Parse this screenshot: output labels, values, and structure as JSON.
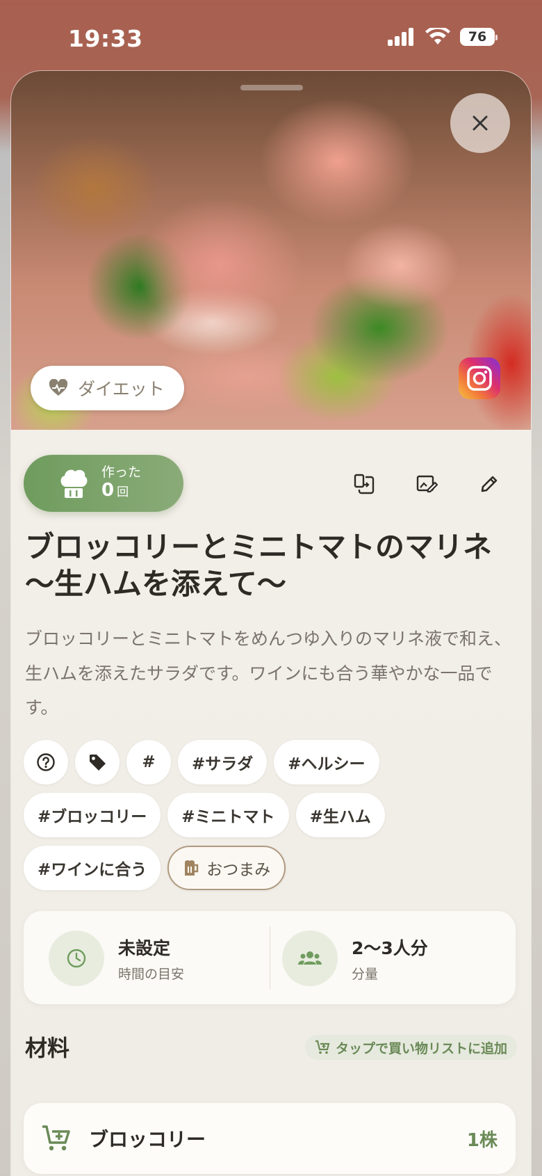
{
  "status": {
    "time": "19:33",
    "battery": "76"
  },
  "hero": {
    "category_chip": "ダイエット"
  },
  "made": {
    "label": "作った",
    "count": "0",
    "unit": "回"
  },
  "recipe": {
    "title": "ブロッコリーとミニトマトのマリネ 〜生ハムを添えて〜",
    "description": "ブロッコリーとミニトマトをめんつゆ入りのマリネ液で和え、生ハムを添えたサラダです。ワインにも合う華やかな一品です。"
  },
  "tags": {
    "hash_icon": "#",
    "items": [
      "#サラダ",
      "#ヘルシー",
      "#ブロッコリー",
      "#ミニトマト",
      "#生ハム",
      "#ワインに合う"
    ],
    "outlined": "おつまみ"
  },
  "info": {
    "time_value": "未設定",
    "time_label": "時間の目安",
    "serving_value": "2〜3人分",
    "serving_label": "分量"
  },
  "ingredients": {
    "title": "材料",
    "shop_hint": "タップで買い物リストに追加",
    "items": [
      {
        "name": "ブロッコリー",
        "qty": "1株"
      }
    ]
  },
  "colors": {
    "accent_green": "#6f9c5e",
    "status_bar": "#a85f4f"
  },
  "icons": [
    "close-icon",
    "heart-pulse-icon",
    "instagram-icon",
    "chef-hat-icon",
    "transfer-icon",
    "edit-image-icon",
    "pencil-icon",
    "question-icon",
    "tag-icon",
    "beer-icon",
    "clock-icon",
    "people-icon",
    "cart-plus-icon"
  ]
}
